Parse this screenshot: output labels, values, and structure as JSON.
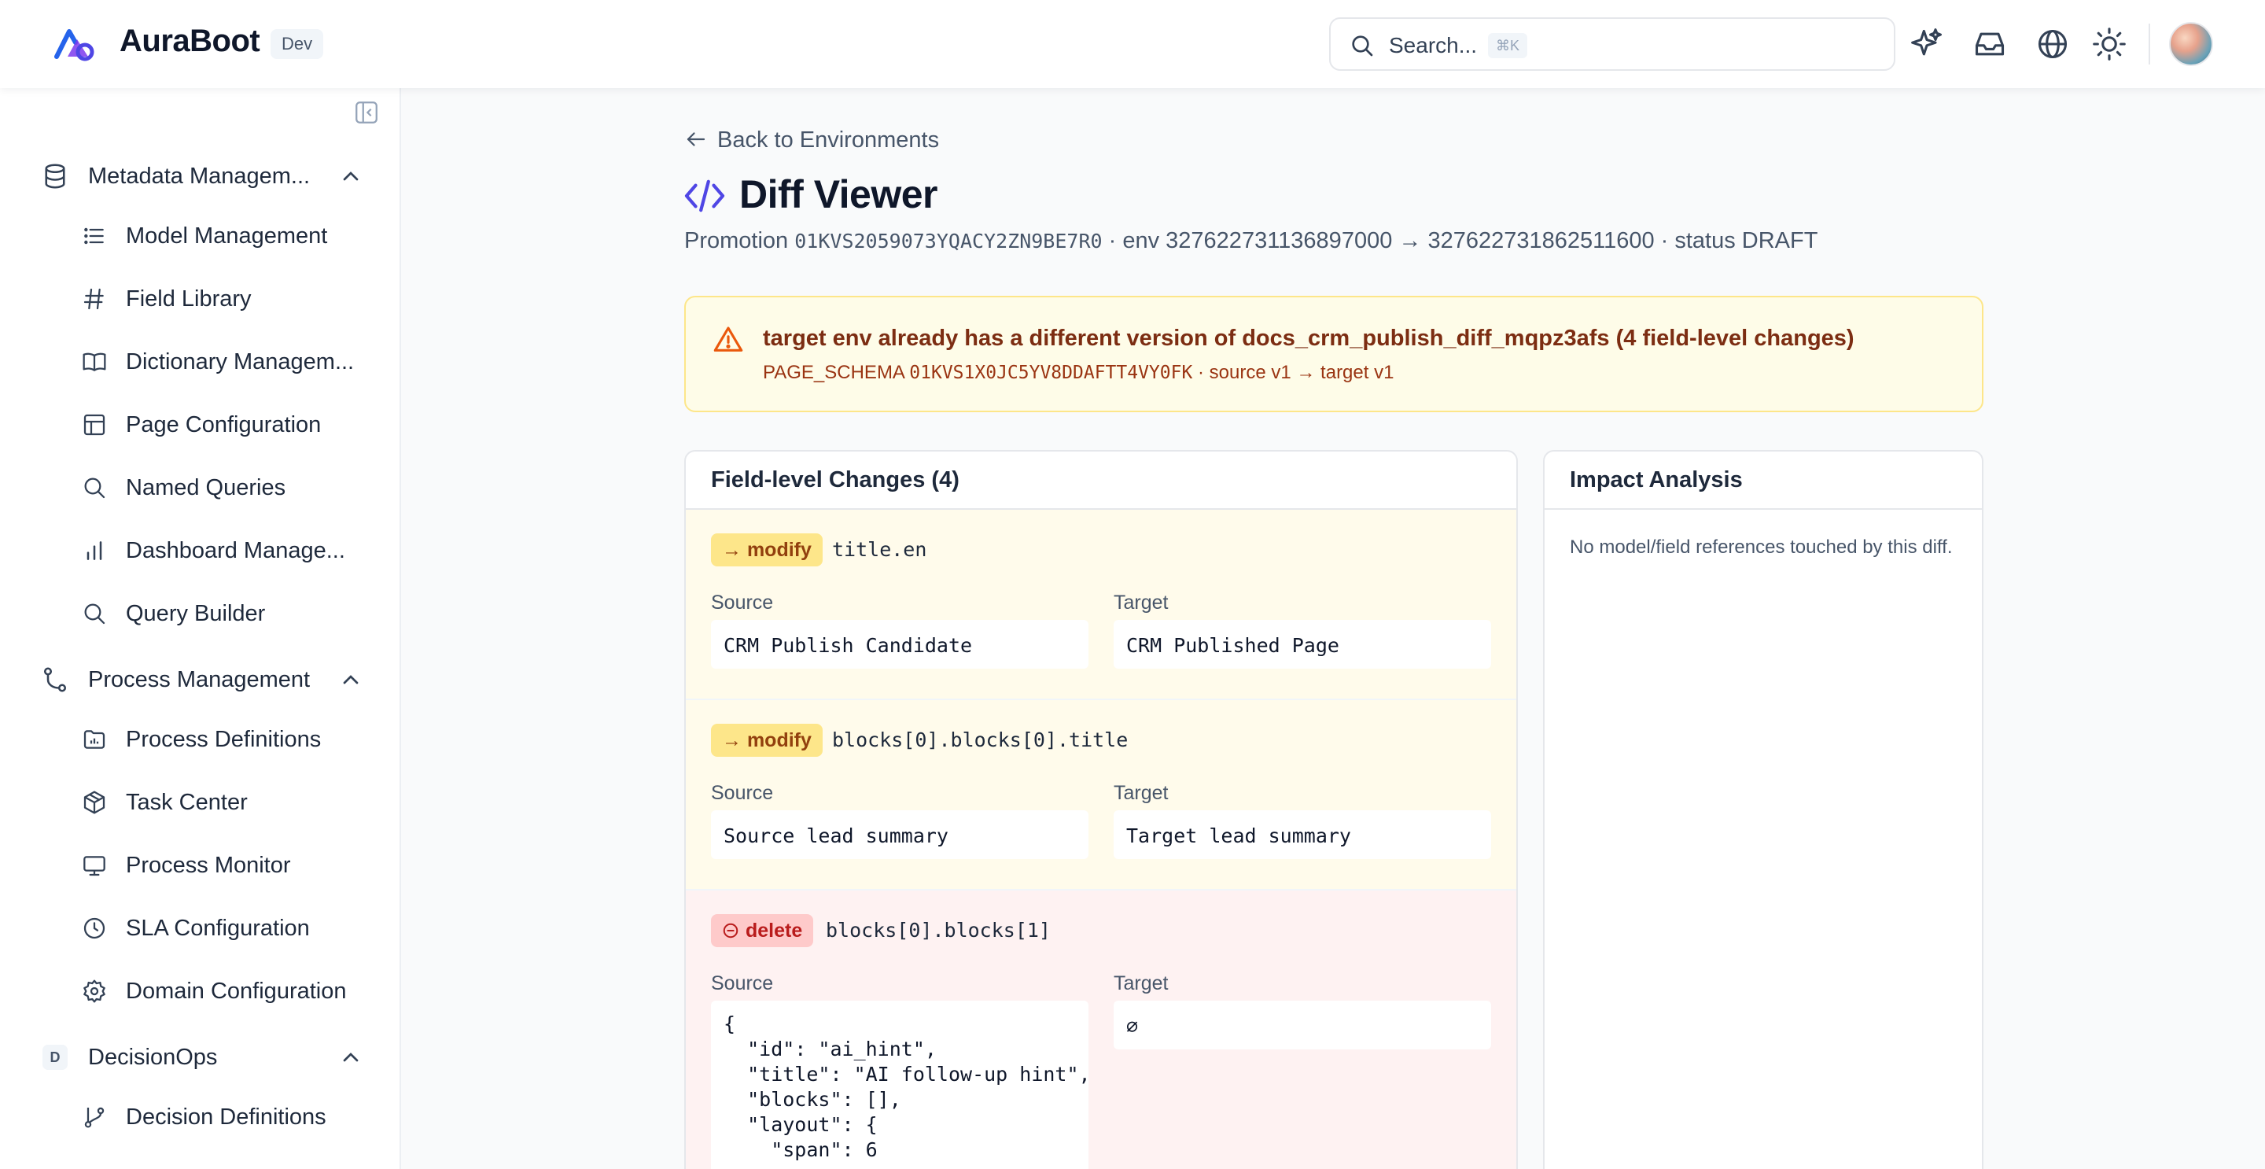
{
  "header": {
    "brand": "AuraBoot",
    "env_badge": "Dev",
    "search_placeholder": "Search...",
    "search_shortcut": "⌘K",
    "icons": [
      "sparkles-icon",
      "inbox-icon",
      "globe-icon",
      "sun-icon"
    ]
  },
  "sidebar": {
    "groups": [
      {
        "label": "Metadata Managem...",
        "icon": "database-icon",
        "items": [
          {
            "label": "Model Management",
            "icon": "list-icon"
          },
          {
            "label": "Field Library",
            "icon": "hash-icon"
          },
          {
            "label": "Dictionary Managem...",
            "icon": "book-icon"
          },
          {
            "label": "Page Configuration",
            "icon": "layout-icon"
          },
          {
            "label": "Named Queries",
            "icon": "search-icon"
          },
          {
            "label": "Dashboard Manage...",
            "icon": "bar-chart-icon"
          },
          {
            "label": "Query Builder",
            "icon": "search-icon"
          }
        ]
      },
      {
        "label": "Process Management",
        "icon": "workflow-icon",
        "items": [
          {
            "label": "Process Definitions",
            "icon": "folder-chart-icon"
          },
          {
            "label": "Task Center",
            "icon": "package-icon"
          },
          {
            "label": "Process Monitor",
            "icon": "monitor-icon"
          },
          {
            "label": "SLA Configuration",
            "icon": "clock-icon"
          },
          {
            "label": "Domain Configuration",
            "icon": "gear-icon"
          }
        ]
      },
      {
        "label": "DecisionOps",
        "badge": "D",
        "items": [
          {
            "label": "Decision Definitions",
            "icon": "git-branch-icon"
          }
        ]
      }
    ]
  },
  "main": {
    "back_link": "Back to Environments",
    "title": "Diff Viewer",
    "sub": {
      "prefix": "Promotion",
      "promotion_id": "01KVS2059073YQACY2ZN9BE7R0",
      "env_text": "· env 327622731136897000 → 327622731862511600 · status DRAFT"
    },
    "warning": {
      "title": "target env already has a different version of docs_crm_publish_diff_mqpz3afs (4 field-level changes)",
      "schema_type": "PAGE_SCHEMA",
      "schema_id": "01KVS1X0JC5YV8DDAFTT4VY0FK",
      "versions": "· source v1 → target v1"
    },
    "changes_card": {
      "title": "Field-level Changes (4)",
      "source_label": "Source",
      "target_label": "Target",
      "changes": [
        {
          "kind": "modify",
          "tag": "→ modify",
          "path": "title.en",
          "source": "CRM Publish Candidate",
          "target": "CRM Published Page"
        },
        {
          "kind": "modify",
          "tag": "→ modify",
          "path": "blocks[0].blocks[0].title",
          "source": "Source lead summary",
          "target": "Target lead summary"
        },
        {
          "kind": "delete",
          "tag": "delete",
          "path": "blocks[0].blocks[1]",
          "source": "{\n  \"id\": \"ai_hint\",\n  \"title\": \"AI follow-up hint\",\n  \"blocks\": [],\n  \"layout\": {\n    \"span\": 6",
          "target": "∅"
        }
      ]
    },
    "impact_card": {
      "title": "Impact Analysis",
      "text": "No model/field references touched by this diff."
    }
  },
  "colors": {
    "accent": "#4f46e5",
    "modify_bg": "#fffbeb",
    "delete_bg": "#fef2f2",
    "warning_bg": "#fefce8"
  }
}
